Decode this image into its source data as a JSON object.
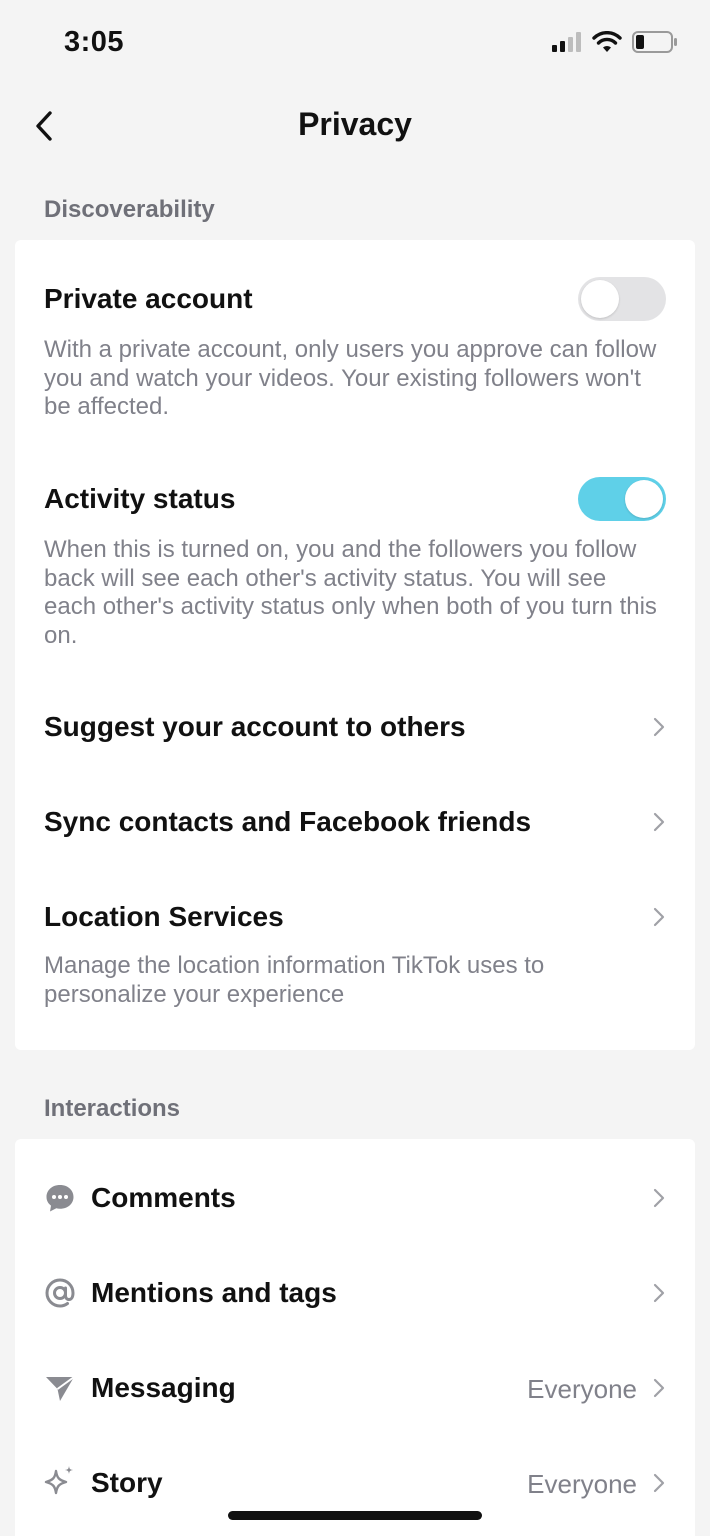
{
  "status_bar": {
    "time": "3:05"
  },
  "nav": {
    "title": "Privacy"
  },
  "discoverability": {
    "header": "Discoverability",
    "private_account": {
      "title": "Private account",
      "description": "With a private account, only users you approve can follow you and watch your videos. Your existing followers won't be affected.",
      "enabled": false
    },
    "activity_status": {
      "title": "Activity status",
      "description": "When this is turned on, you and the followers you follow back will see each other's activity status. You will see each other's activity status only when both of you turn this on.",
      "enabled": true
    },
    "suggest": {
      "title": "Suggest your account to others"
    },
    "sync": {
      "title": "Sync contacts and Facebook friends"
    },
    "location": {
      "title": "Location Services",
      "description": "Manage the location information TikTok uses to personalize your experience"
    }
  },
  "interactions": {
    "header": "Interactions",
    "comments": {
      "title": "Comments",
      "icon": "comment-icon"
    },
    "mentions": {
      "title": "Mentions and tags",
      "icon": "at-icon"
    },
    "messaging": {
      "title": "Messaging",
      "value": "Everyone",
      "icon": "send-icon"
    },
    "story": {
      "title": "Story",
      "value": "Everyone",
      "icon": "sparkle-icon"
    }
  },
  "colors": {
    "toggle_on": "#5fd0e8",
    "toggle_off": "#e3e3e5",
    "background": "#f4f4f4"
  }
}
